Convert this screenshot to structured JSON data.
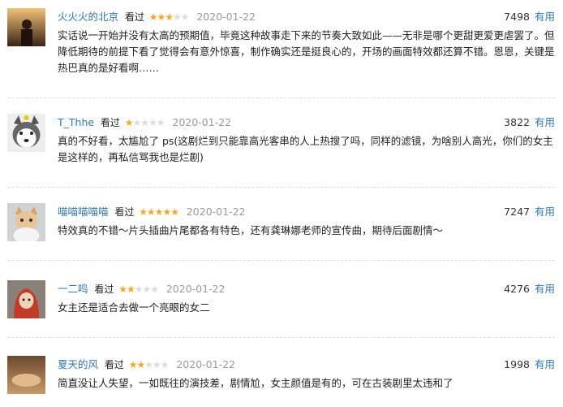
{
  "comments": [
    {
      "user": "火火火的北京",
      "watched": "看过",
      "stars": "★★★★★",
      "rating": 3,
      "date": "2020-01-22",
      "votes": "7498",
      "useful": "有用",
      "text": "实话说一开始并没有太高的预期值，毕竟这种故事走下来的节奏大致如此——无非是哪个更甜更爱更虐罢了。但降低期待的前提下看了觉得会有意外惊喜，制作确实还是挺良心的，开场的画面特效都还算不错。恩恩，关键是热巴真的是好看啊……"
    },
    {
      "user": "T_Thhe",
      "watched": "看过",
      "stars": "★★★★★",
      "rating": 1,
      "date": "2020-01-22",
      "votes": "3822",
      "useful": "有用",
      "text": "真的不好看，太尴尬了 ps(这剧烂到只能靠高光客串的人上热搜了吗，同样的滤镜，为啥别人高光，你们的女主是这样的，再私信骂我也是烂剧)"
    },
    {
      "user": "喵喵喵喵喵",
      "watched": "看过",
      "stars": "★★★★★",
      "rating": 5,
      "date": "2020-01-22",
      "votes": "7247",
      "useful": "有用",
      "text": "特效真的不错～片头插曲片尾都各有特色，还有龚琳娜老师的宣传曲，期待后面剧情～"
    },
    {
      "user": "一二鸣",
      "watched": "看过",
      "stars": "★★★★★",
      "rating": 2,
      "date": "2020-01-22",
      "votes": "4276",
      "useful": "有用",
      "text": "女主还是适合去做一个亮眼的女二"
    },
    {
      "user": "夏天的风",
      "watched": "看过",
      "stars": "★★★★★",
      "rating": 2,
      "date": "2020-01-22",
      "votes": "1998",
      "useful": "有用",
      "text": "简直没让人失望，一如既往的演技差，剧情尬，女主颜值是有的，可在古装剧里太违和了"
    }
  ],
  "colors": {
    "link": "#3377aa",
    "star_on": "#f6a62c",
    "star_off": "#dcdcdc",
    "date": "#999999"
  },
  "icons": {
    "avatar": "user-avatar-icon",
    "star": "star-icon"
  }
}
